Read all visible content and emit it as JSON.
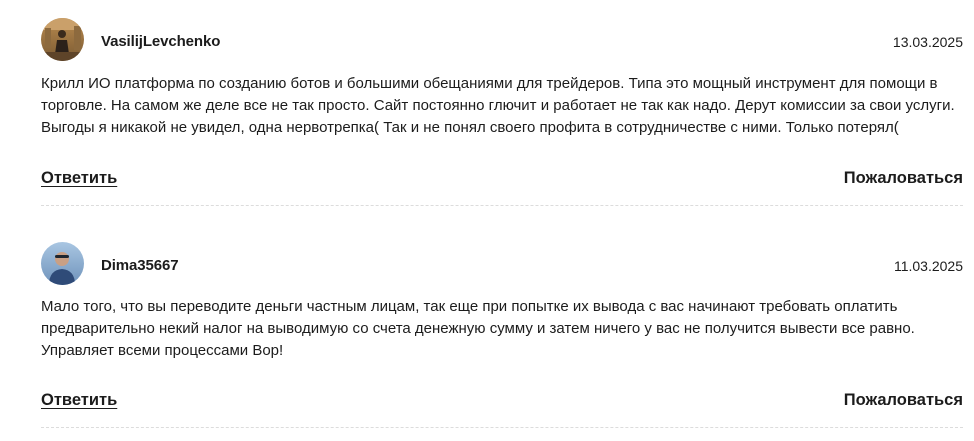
{
  "reviews": [
    {
      "username": "VasilijLevchenko",
      "date": "13.03.2025",
      "text": "Крилл ИО платформа по созданию ботов и большими обещаниями для трейдеров. Типа это мощный инструмент для помощи в торговле. На самом же деле все не так просто. Сайт постоянно глючит и работает не так как надо. Дерут комиссии за свои услуги. Выгоды я никакой не увидел, одна нервотрепка( Так и не понял своего профита в сотрудничестве с ними. Только потерял(",
      "reply_label": "Ответить",
      "report_label": "Пожаловаться"
    },
    {
      "username": "Dima35667",
      "date": "11.03.2025",
      "text": "Мало того, что вы переводите деньги частным лицам, так еще при попытке их вывода с вас начинают требовать оплатить предварительно некий налог на выводимую со счета денежную сумму и затем ничего у вас не получится вывести все равно. Управляет всеми процессами Вор!",
      "reply_label": "Ответить",
      "report_label": "Пожаловаться"
    }
  ],
  "colors": {
    "text": "#1c1c1c",
    "divider": "#dcdcdc",
    "background": "#ffffff"
  }
}
